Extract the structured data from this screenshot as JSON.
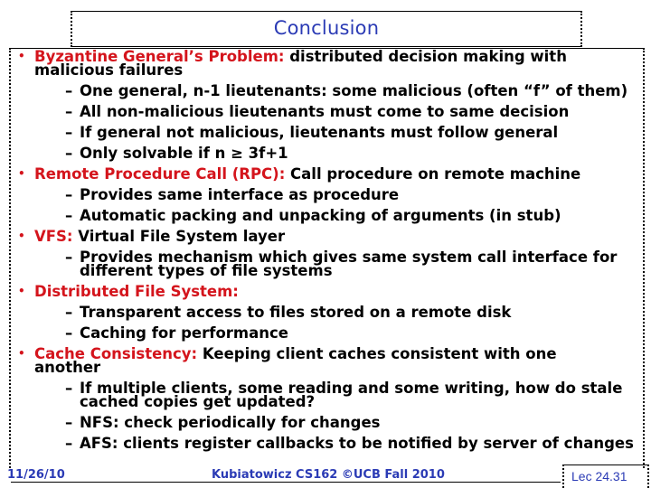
{
  "slide": {
    "title": "Conclusion",
    "colors": {
      "title": "#2b3bb5",
      "term": "#d4141c",
      "body": "#000000",
      "footer": "#2b3bb5"
    },
    "items": [
      {
        "term": "Byzantine General’s Problem:",
        "text_line1": " distributed decision making with",
        "text_line2": "malicious failures",
        "subitems": [
          "One general, n-1 lieutenants: some malicious (often “f” of them)",
          "All non-malicious lieutenants must come to same decision",
          "If general not malicious, lieutenants must follow general",
          "Only solvable if n ≥ 3f+1"
        ]
      },
      {
        "term": "Remote Procedure Call (RPC):",
        "text_line1": " Call procedure on remote machine",
        "subitems": [
          "Provides same interface as procedure",
          "Automatic packing and unpacking of arguments (in stub)"
        ]
      },
      {
        "term": "VFS:",
        "text_line1": " Virtual File System layer",
        "subitems_wrapped": [
          {
            "line1": "Provides mechanism which gives same system call interface for",
            "line2": "different types of file systems"
          }
        ]
      },
      {
        "term": "Distributed File System:",
        "text_line1": "",
        "subitems": [
          "Transparent access to files stored on a remote disk",
          "Caching for performance"
        ]
      },
      {
        "term": "Cache Consistency:",
        "text_line1": " Keeping client caches consistent with one",
        "text_line2": "another",
        "subitems_wrapped": [
          {
            "line1": "If multiple clients, some reading and some writing, how do stale",
            "line2": "cached copies get updated?"
          }
        ],
        "subitems": [
          "NFS: check periodically for changes",
          "AFS: clients register callbacks to be notified by server of changes"
        ]
      }
    ],
    "bullet_glyph": "•",
    "dash_glyph": "–"
  },
  "footer": {
    "date": "11/26/10",
    "course": "Kubiatowicz CS162 ©UCB Fall 2010",
    "page": "Lec 24.31"
  }
}
